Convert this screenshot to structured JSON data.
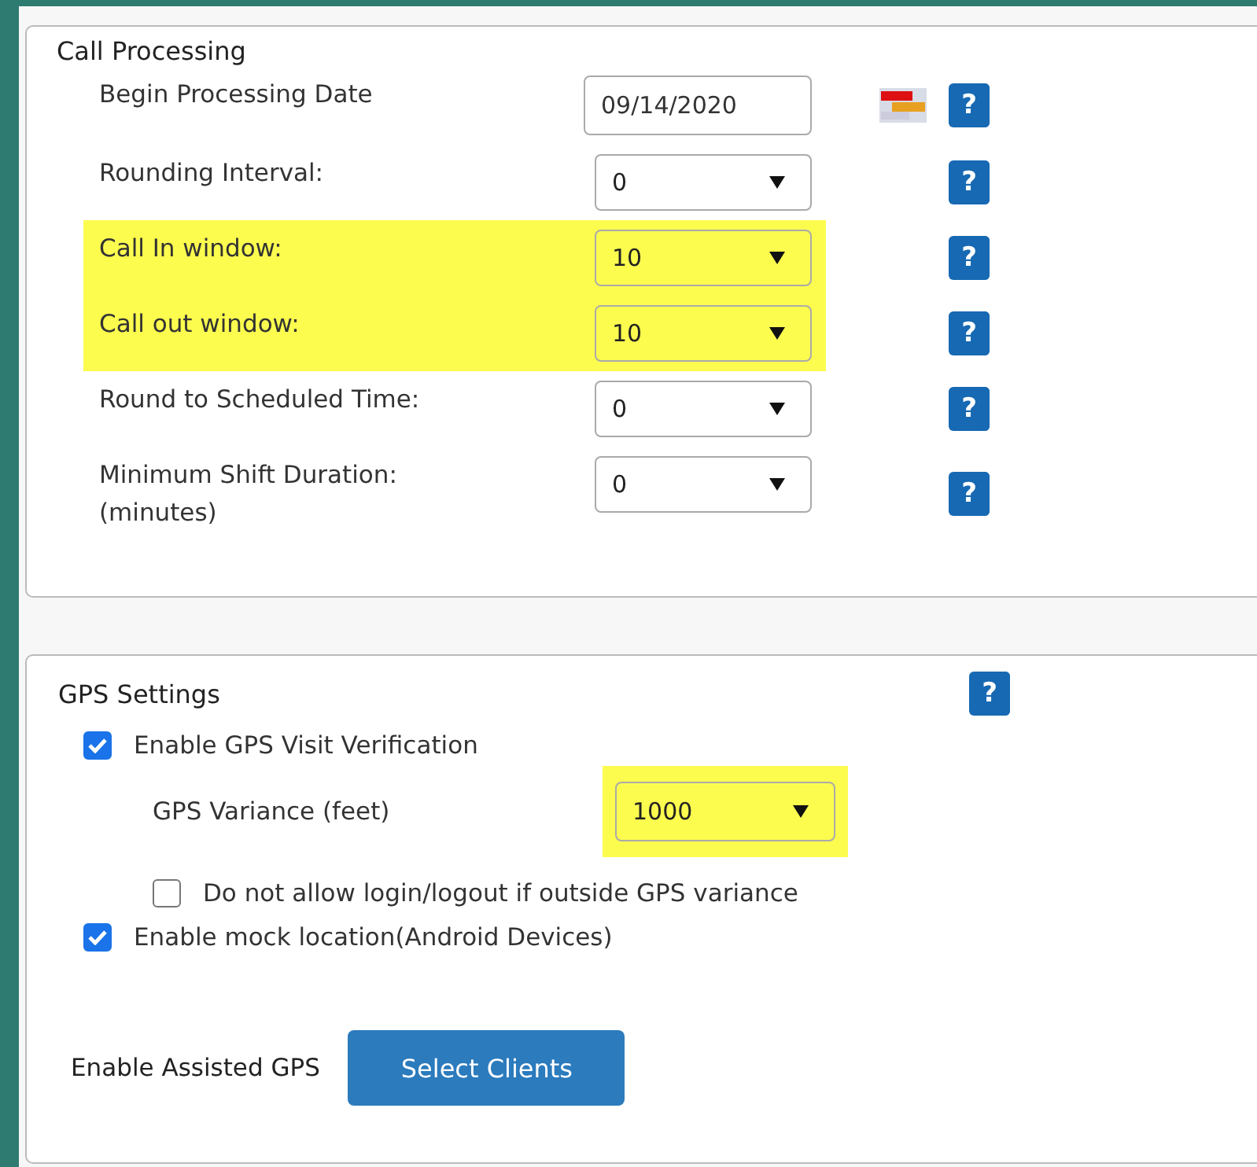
{
  "call_processing": {
    "title": "Call Processing",
    "rows": [
      {
        "kind": "date",
        "label": "Begin Processing Date",
        "value": "09/14/2020",
        "highlighted": false,
        "help": "?"
      },
      {
        "kind": "select",
        "label": "Rounding Interval:",
        "value": "0",
        "highlighted": false,
        "help": "?"
      },
      {
        "kind": "select",
        "label": "Call In window:",
        "value": "10",
        "highlighted": true,
        "help": "?"
      },
      {
        "kind": "select",
        "label": "Call out window:",
        "value": "10",
        "highlighted": true,
        "help": "?"
      },
      {
        "kind": "select",
        "label": "Round to Scheduled Time:",
        "value": "0",
        "highlighted": false,
        "help": "?"
      },
      {
        "kind": "select",
        "label": "Minimum Shift Duration:",
        "sublabel": "(minutes)",
        "value": "0",
        "highlighted": false,
        "help": "?"
      }
    ]
  },
  "gps_settings": {
    "title": "GPS Settings",
    "help": "?",
    "items": [
      {
        "kind": "checkbox",
        "label": "Enable GPS Visit Verification",
        "checked": true,
        "children": [
          {
            "kind": "select",
            "label": "GPS Variance (feet)",
            "value": "1000",
            "highlighted": true
          },
          {
            "kind": "checkbox",
            "label": "Do not allow login/logout if outside GPS variance",
            "checked": false
          }
        ]
      },
      {
        "kind": "checkbox",
        "label": "Enable mock location(Android Devices)",
        "checked": true
      }
    ],
    "assisted": {
      "label": "Enable Assisted GPS",
      "button": "Select Clients"
    }
  }
}
